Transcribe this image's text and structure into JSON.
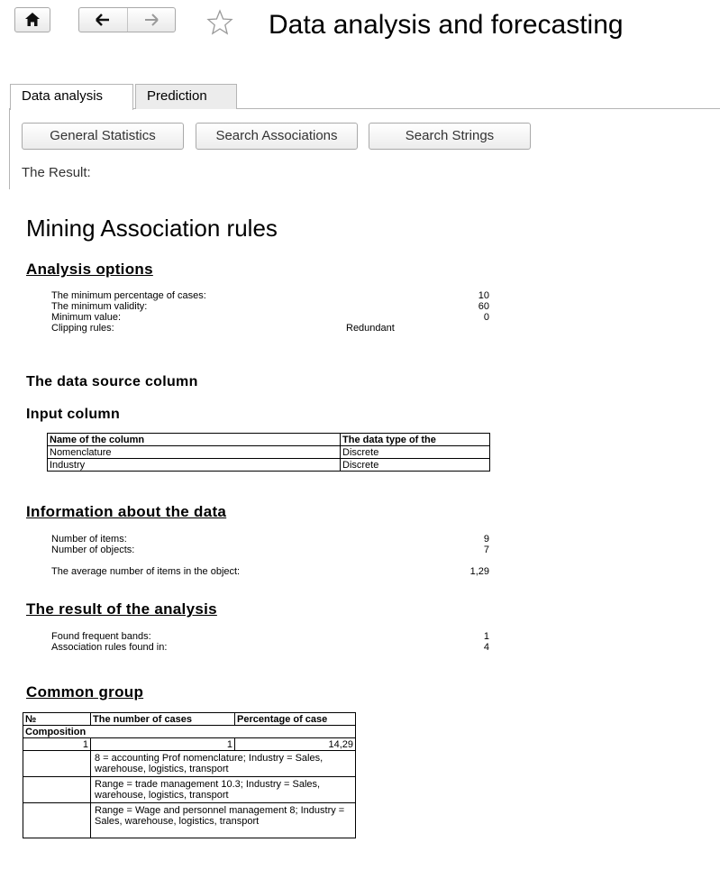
{
  "window": {
    "title": "Data analysis and forecasting"
  },
  "icons": {
    "home": "home-icon",
    "back": "arrow-left-icon",
    "forward": "arrow-right-icon",
    "favorite": "star-icon"
  },
  "tabs": [
    {
      "label": "Data analysis"
    },
    {
      "label": "Prediction"
    }
  ],
  "buttons": {
    "general": "General Statistics",
    "assoc": "Search Associations",
    "strings": "Search Strings"
  },
  "result_label": "The Result:",
  "report": {
    "title": "Mining Association rules",
    "analysis_options": {
      "heading": "Analysis options",
      "rows": [
        {
          "label": "The minimum percentage of cases:",
          "value": "10"
        },
        {
          "label": "The minimum validity:",
          "value": "60"
        },
        {
          "label": "Minimum value:",
          "value": "0"
        },
        {
          "label": "Clipping rules:",
          "value": "Redundant"
        }
      ]
    },
    "data_source_heading": "The data source column",
    "input_column": {
      "heading": "Input column",
      "headers": [
        "Name of the column",
        "The data type of the"
      ],
      "rows": [
        [
          "Nomenclature",
          "Discrete"
        ],
        [
          "Industry",
          "Discrete"
        ]
      ]
    },
    "info": {
      "heading": "Information about the data",
      "rows": [
        {
          "label": "Number of items:",
          "value": "9"
        },
        {
          "label": "Number of objects:",
          "value": "7"
        },
        {
          "label": "The average number of items in the object:",
          "value": "1,29"
        }
      ]
    },
    "result": {
      "heading": "The result of the analysis",
      "rows": [
        {
          "label": "Found frequent bands:",
          "value": "1"
        },
        {
          "label": "Association rules found in:",
          "value": "4"
        }
      ]
    },
    "common_group": {
      "heading": "Common group",
      "headers": [
        "№",
        "The number of cases",
        "Percentage of case"
      ],
      "composition_label": "Composition",
      "row": [
        "1",
        "1",
        "14,29"
      ],
      "items": [
        "8 = accounting Prof nomenclature; Industry = Sales, warehouse, logistics, transport",
        "Range = trade management 10.3; Industry = Sales, warehouse, logistics, transport",
        "Range = Wage and personnel management 8; Industry = Sales, warehouse, logistics, transport"
      ]
    }
  }
}
